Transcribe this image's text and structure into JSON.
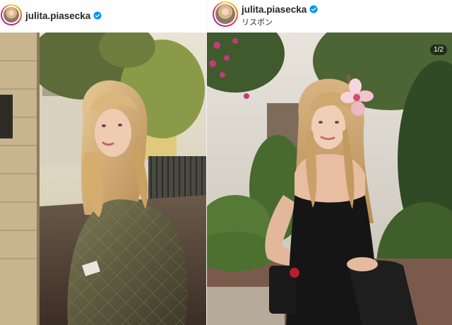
{
  "posts": [
    {
      "username": "julita.piasecka",
      "verified": true,
      "location": "",
      "photo": {
        "icon": "photo-woman-green-quilted-jacket"
      }
    },
    {
      "username": "julita.piasecka",
      "verified": true,
      "location": "リスボン",
      "photo": {
        "icon": "photo-woman-black-dress-hibiscus"
      },
      "carousel_counter": "1/2"
    }
  ],
  "colors": {
    "verified_blue": "#0095f6",
    "text": "#262626"
  }
}
